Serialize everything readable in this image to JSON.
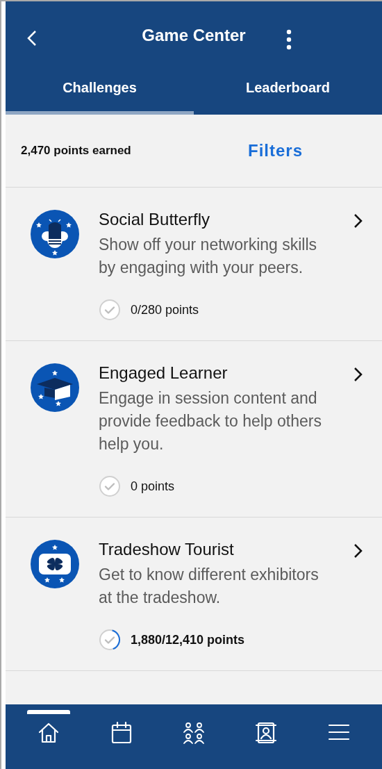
{
  "header": {
    "title": "Game Center"
  },
  "tabs": [
    {
      "label": "Challenges",
      "selected": true
    },
    {
      "label": "Leaderboard",
      "selected": false
    }
  ],
  "summary": {
    "points": "2,470 points earned",
    "filters": "Filters"
  },
  "challenges": [
    {
      "kind": "butterfly",
      "title": "Social Butterfly",
      "description": "Show off your networking skills by engaging with your peers.",
      "points": "0/280 points",
      "in_progress": false
    },
    {
      "kind": "cap",
      "title": "Engaged Learner",
      "description": "Engage in session content and provide feedback to help others help you.",
      "points": "0 points",
      "in_progress": false
    },
    {
      "kind": "booth",
      "title": "Tradeshow Tourist",
      "description": "Get to know different exhibitors at the tradeshow.",
      "points": "1,880/12,410 points",
      "in_progress": true
    }
  ],
  "nav": [
    {
      "kind": "home",
      "selected": true
    },
    {
      "kind": "calendar",
      "selected": false
    },
    {
      "kind": "people",
      "selected": false
    },
    {
      "kind": "contact",
      "selected": false
    },
    {
      "kind": "menu",
      "selected": false
    }
  ]
}
